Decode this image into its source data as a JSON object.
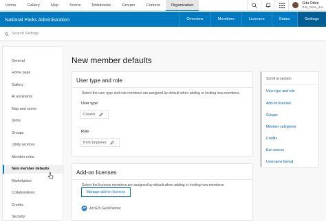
{
  "topnav": {
    "links": [
      "Home",
      "Gallery",
      "Map",
      "Scene",
      "Notebooks",
      "Groups",
      "Content",
      "Organization"
    ],
    "active": "Organization",
    "icons": [
      "search-icon",
      "bell-icon",
      "grid-icon"
    ],
    "user": {
      "name": "Gita Öden",
      "id": "Gita_Oden_doc"
    }
  },
  "orgbar": {
    "title": "National Parks Administration",
    "tabs": [
      "Overview",
      "Members",
      "Licenses",
      "Status",
      "Settings"
    ],
    "active": "Settings"
  },
  "search": {
    "placeholder": "Search Settings"
  },
  "sidebar": {
    "items": [
      "General",
      "Home page",
      "Gallery",
      "AI assistants",
      "Map and scene",
      "Items",
      "Groups",
      "Utility services",
      "Member roles",
      "New member defaults",
      "Marketplace",
      "Collaborations",
      "Credits",
      "Security"
    ],
    "active": "New member defaults"
  },
  "page": {
    "title": "New member defaults"
  },
  "user_type_card": {
    "title": "User type and role",
    "description": "Select the user type and role members are assigned by default when adding or inviting new members.",
    "user_type_label": "User type",
    "user_type_value": "Creator",
    "role_label": "Role",
    "role_value": "Park Engineer"
  },
  "addon_card": {
    "title": "Add-on licenses",
    "description": "Select the licenses members are assigned by default when adding or inviting new members.",
    "button_label": "Manage add-on licenses",
    "license_name": "ArcGIS GeoPlanner"
  },
  "scroll_panel": {
    "heading": "Scroll to section",
    "items": [
      "User type and role",
      "Add-on licenses",
      "Groups",
      "Member categories",
      "Credits",
      "Esri access",
      "Username format"
    ]
  },
  "colors": {
    "brand_blue": "#0079c1",
    "active_tab": "#005e95"
  }
}
